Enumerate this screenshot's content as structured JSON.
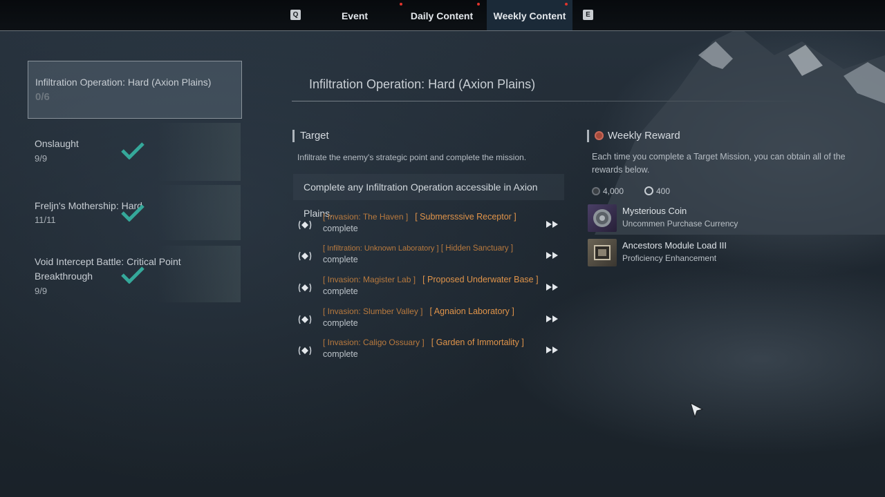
{
  "nav": {
    "prev_key": "Q",
    "next_key": "E",
    "tabs": [
      {
        "label": "Event"
      },
      {
        "label": "Daily Content"
      },
      {
        "label": "Weekly Content"
      }
    ]
  },
  "sidebar": {
    "items": [
      {
        "title": "Infiltration Operation: Hard (Axion Plains)",
        "count": "0/6"
      },
      {
        "title": "Onslaught",
        "count": "9/9"
      },
      {
        "title": "Freljn's Mothership: Hard",
        "count": "11/11"
      },
      {
        "title_line1": "Void Intercept Battle: Critical Point",
        "title_line2": "Breakthrough",
        "count": "9/9"
      }
    ]
  },
  "main": {
    "title": "Infiltration Operation: Hard (Axion Plains)",
    "target": {
      "heading": "Target",
      "description": "Infiltrate the enemy's strategic point and complete the mission.",
      "condition": "Complete any Infiltration Operation accessible in Axion Plains.",
      "tasks": [
        {
          "area": "[ Invasion: The Haven ]",
          "mission": "[ Submersssive Receptor ]",
          "status": "complete"
        },
        {
          "area": "[ Infiltration: Unknown Laboratory ]",
          "mission": "[ Hidden Sanctuary ]",
          "status": "complete"
        },
        {
          "area": "[ Invasion: Magister Lab ]",
          "mission": "[ Proposed Underwater Base ]",
          "status": "complete"
        },
        {
          "area": "[ Invasion: Slumber Valley ]",
          "mission": "[ Agnaion Laboratory ]",
          "status": "complete"
        },
        {
          "area": "[ Invasion: Caligo Ossuary ]",
          "mission": "[ Garden of Immortality ]",
          "status": "complete"
        }
      ]
    },
    "reward": {
      "heading": "Weekly Reward",
      "description_line1": "Each time you complete a Target Mission, you can obtain all of the",
      "description_line2": "rewards below.",
      "currency": [
        {
          "icon": "gold-coin-icon",
          "amount": "4,000"
        },
        {
          "icon": "exp-ring-icon",
          "amount": "400"
        }
      ],
      "items": [
        {
          "name": "Mysterious Coin",
          "type": "Uncommen Purchase Currency"
        },
        {
          "name": "Ancestors Module Load III",
          "type": "Proficiency Enhancement"
        }
      ]
    }
  },
  "colors": {
    "accent_orange": "#e0944a",
    "check_teal": "#35a89a",
    "active_tab": "#1b2a38",
    "notification_red": "#e0342c"
  }
}
